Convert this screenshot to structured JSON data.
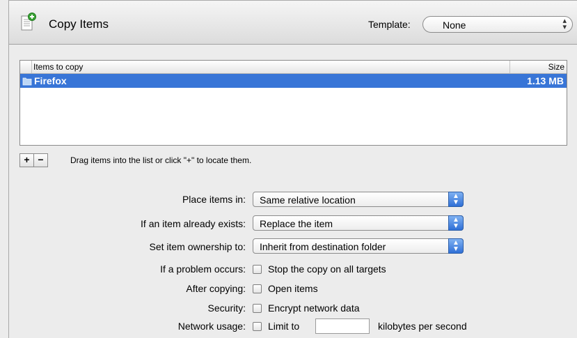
{
  "header": {
    "title": "Copy Items",
    "template_label": "Template:",
    "template_value": "None",
    "icon": "document-add-icon"
  },
  "list": {
    "col_items": "Items to copy",
    "col_size": "Size",
    "rows": [
      {
        "name": "Firefox",
        "size": "1.13 MB",
        "icon": "folder-icon",
        "selected": true
      }
    ]
  },
  "list_controls": {
    "add": "+",
    "remove": "−",
    "hint": "Drag items into the list or click \"+\" to locate them."
  },
  "options": {
    "place_label": "Place items in:",
    "place_value": "Same relative location",
    "exists_label": "If an item already exists:",
    "exists_value": "Replace the item",
    "ownership_label": "Set item ownership to:",
    "ownership_value": "Inherit from destination folder",
    "problem_label": "If a problem occurs:",
    "problem_check": "Stop the copy on all targets",
    "after_label": "After copying:",
    "after_check": "Open items",
    "security_label": "Security:",
    "security_check": "Encrypt network data",
    "network_label": "Network usage:",
    "network_check": "Limit to",
    "network_value": "",
    "network_unit": "kilobytes per second"
  },
  "colors": {
    "selection": "#3875d7",
    "popup_button": "#2f6fd6",
    "background": "#ececec"
  }
}
